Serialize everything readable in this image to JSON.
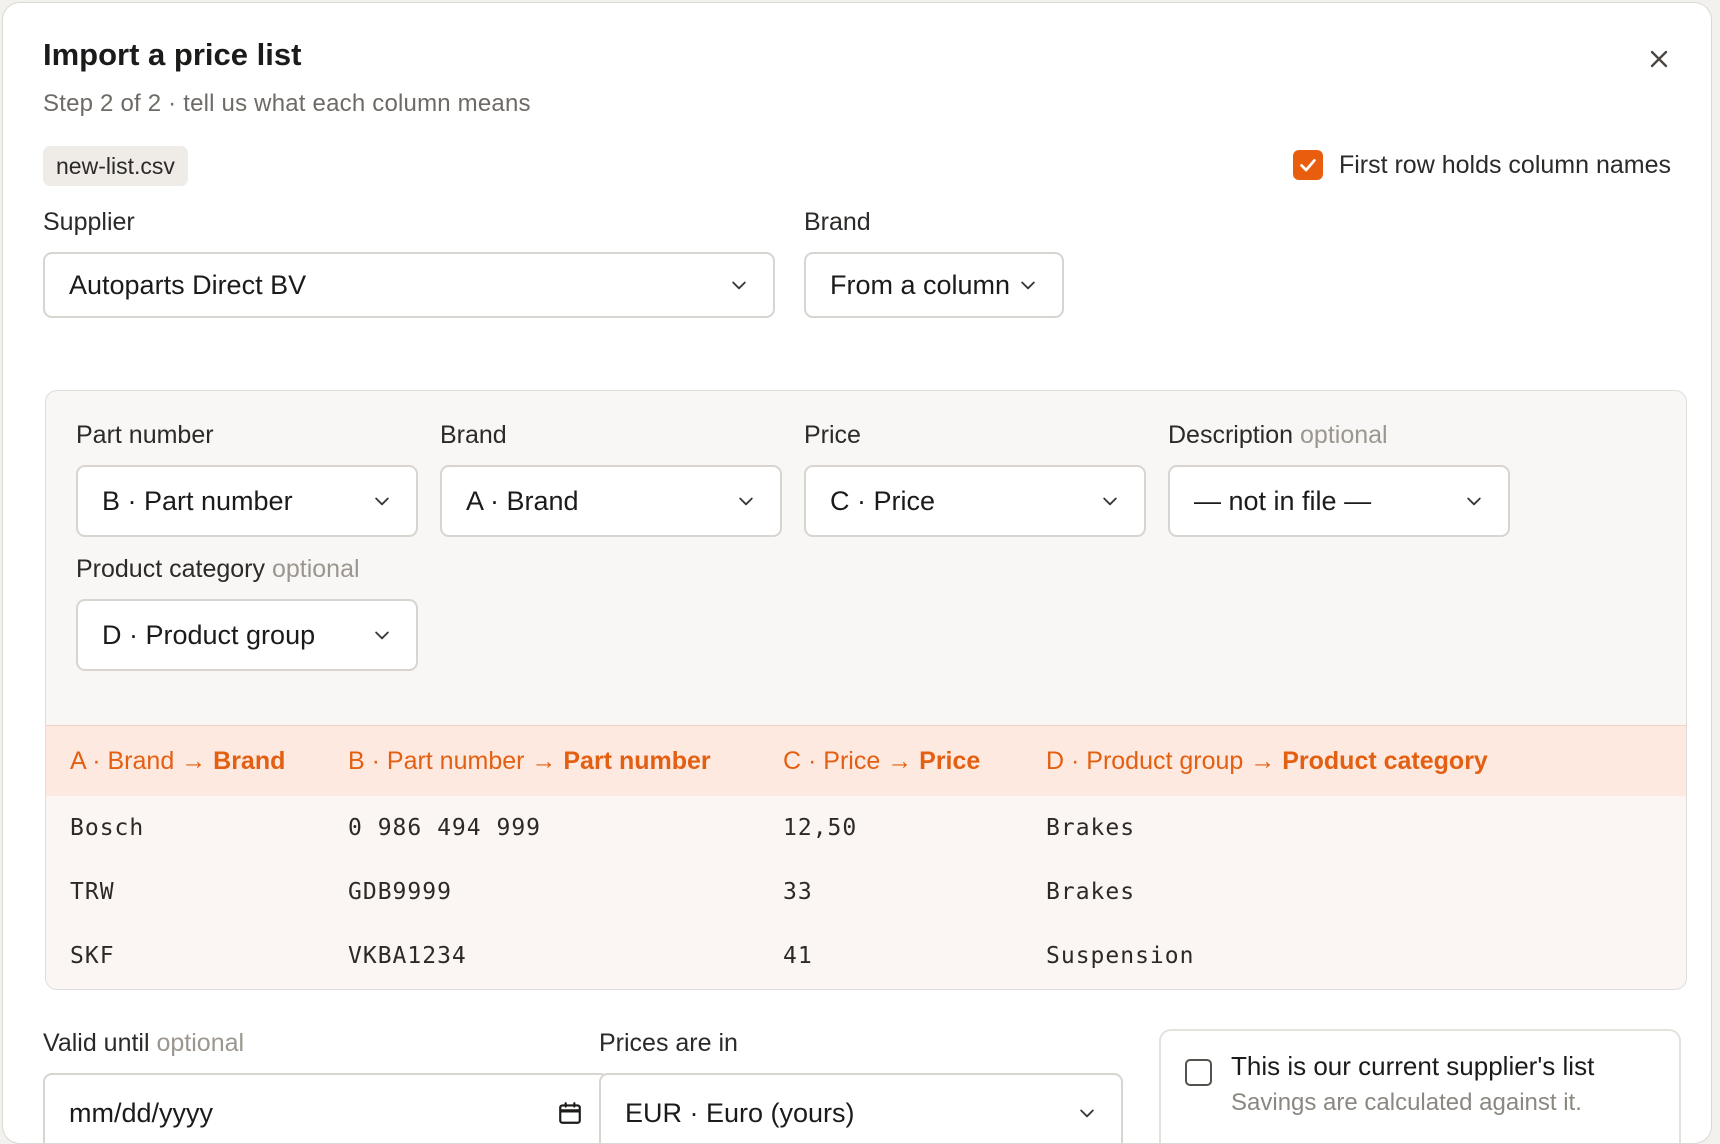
{
  "dialog": {
    "title": "Import a price list",
    "subtitle": "Step 2 of 2 · tell us what each column means",
    "file_name": "new-list.csv",
    "header_row_label": "First row holds column names",
    "header_row_checked": true,
    "accent_color": "#e85d0e"
  },
  "top_fields": {
    "supplier": {
      "label": "Supplier",
      "value": "Autoparts Direct BV"
    },
    "brand": {
      "label": "Brand",
      "value": "From a column"
    }
  },
  "mapping": {
    "part_number": {
      "label": "Part number",
      "value": "B · Part number"
    },
    "brand": {
      "label": "Brand",
      "value": "A · Brand"
    },
    "price": {
      "label": "Price",
      "value": "C · Price"
    },
    "description": {
      "label": "Description",
      "optional": "optional",
      "value": "— not in file —"
    },
    "category": {
      "label": "Product category",
      "optional": "optional",
      "value": "D · Product group"
    }
  },
  "preview": {
    "columns": [
      {
        "source": "A · Brand",
        "arrow": "→",
        "target": "Brand"
      },
      {
        "source": "B · Part number",
        "arrow": "→",
        "target": "Part number"
      },
      {
        "source": "C · Price",
        "arrow": "→",
        "target": "Price"
      },
      {
        "source": "D · Product group",
        "arrow": "→",
        "target": "Product category"
      }
    ],
    "rows": [
      [
        "Bosch",
        "0 986 494 999",
        "12,50",
        "Brakes"
      ],
      [
        "TRW",
        "GDB9999",
        "33",
        "Brakes"
      ],
      [
        "SKF",
        "VKBA1234",
        "41",
        "Suspension"
      ]
    ]
  },
  "bottom": {
    "valid_until": {
      "label": "Valid until",
      "optional": "optional",
      "placeholder": "mm/dd/yyyy"
    },
    "currency": {
      "label": "Prices are in",
      "value": "EUR · Euro (yours)"
    },
    "current_supplier": {
      "title": "This is our current supplier's list",
      "subtitle": "Savings are calculated against it.",
      "checked": false
    }
  }
}
